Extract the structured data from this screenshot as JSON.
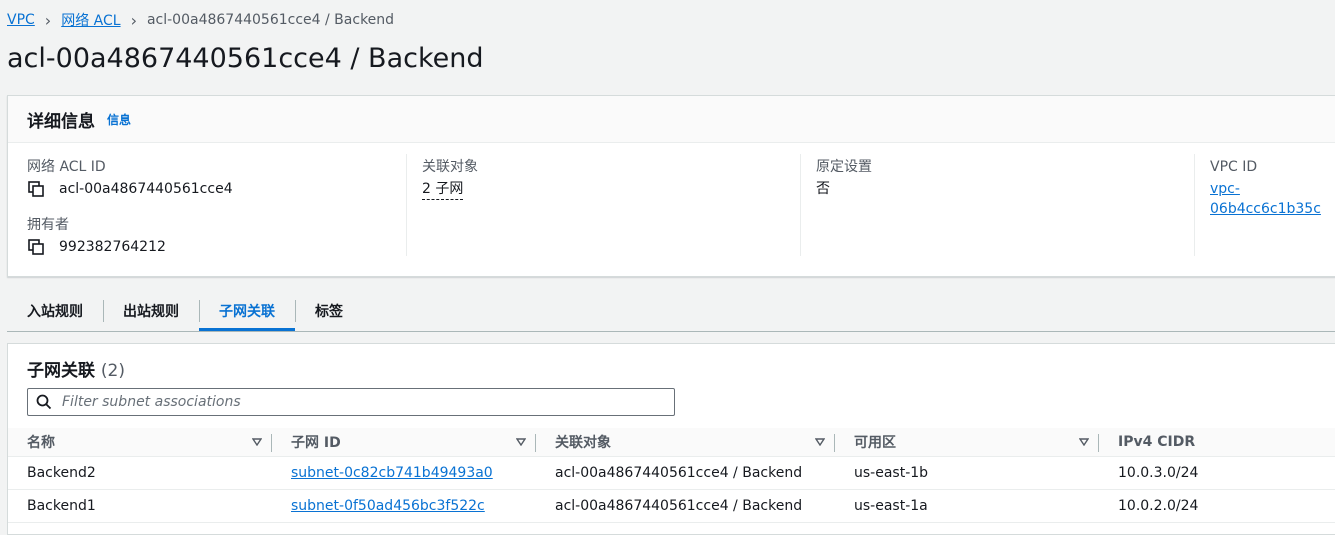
{
  "breadcrumb": {
    "vpc": "VPC",
    "acl": "网络 ACL",
    "current": "acl-00a4867440561cce4 / Backend"
  },
  "page_title": "acl-00a4867440561cce4 / Backend",
  "details": {
    "title": "详细信息",
    "info": "信息",
    "acl_id_label": "网络 ACL ID",
    "acl_id_value": "acl-00a4867440561cce4",
    "owner_label": "拥有者",
    "owner_value": "992382764212",
    "assoc_label": "关联对象",
    "assoc_value": "2 子网",
    "default_label": "原定设置",
    "default_value": "否",
    "vpc_label": "VPC ID",
    "vpc_value": "vpc-06b4cc6c1b35c"
  },
  "tabs": [
    "入站规则",
    "出站规则",
    "子网关联",
    "标签"
  ],
  "subnet_panel": {
    "title": "子网关联",
    "count": "(2)",
    "search_placeholder": "Filter subnet associations"
  },
  "table": {
    "headers": [
      "名称",
      "子网 ID",
      "关联对象",
      "可用区",
      "IPv4 CIDR"
    ],
    "rows": [
      [
        "Backend2",
        "subnet-0c82cb741b49493a0",
        "acl-00a4867440561cce4 / Backend",
        "us-east-1b",
        "10.0.3.0/24"
      ],
      [
        "Backend1",
        "subnet-0f50ad456bc3f522c",
        "acl-00a4867440561cce4 / Backend",
        "us-east-1a",
        "10.0.2.0/24"
      ]
    ]
  },
  "colors": {
    "link": "#0972d3",
    "text": "#16191f",
    "muted": "#545b64"
  }
}
